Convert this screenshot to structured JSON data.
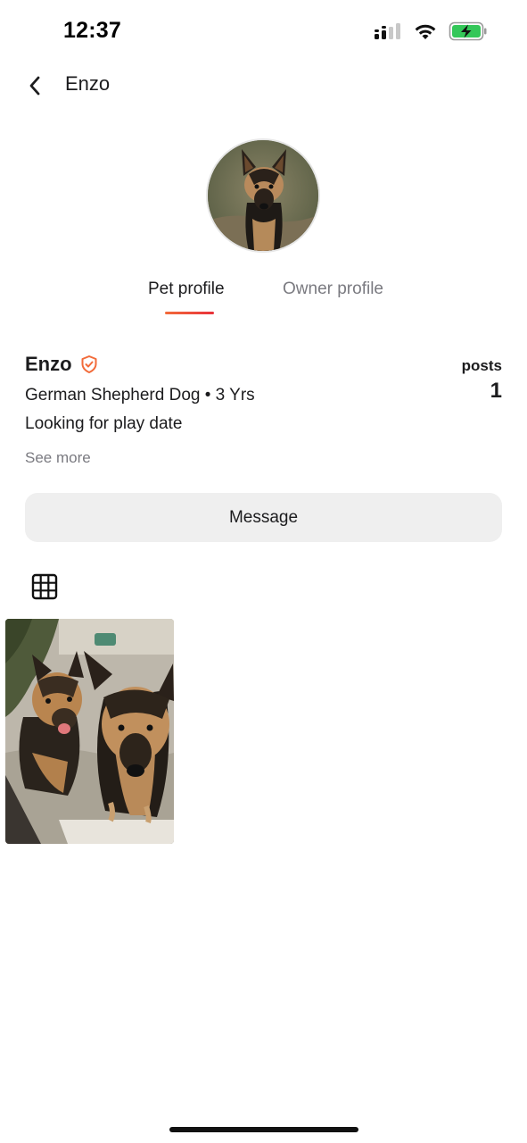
{
  "status_bar": {
    "time": "12:37",
    "icons": [
      "cellular-signal-icon",
      "wifi-icon",
      "battery-charging-icon"
    ]
  },
  "header": {
    "back_icon": "chevron-left-icon",
    "title": "Enzo"
  },
  "tabs": [
    {
      "label": "Pet profile",
      "active": true
    },
    {
      "label": "Owner profile",
      "active": false
    }
  ],
  "profile": {
    "name": "Enzo",
    "verified_icon": "shield-check-icon",
    "breed_age": "German Shepherd Dog • 3 Yrs",
    "bio": "Looking for play date",
    "see_more": "See more",
    "posts_label": "posts",
    "posts_count": "1"
  },
  "actions": {
    "message_label": "Message"
  },
  "posts_view": {
    "icon": "grid-icon"
  },
  "colors": {
    "accent": "#f26b3a",
    "tab_active_underline_end": "#e8313a",
    "muted_text": "#7a7a80",
    "button_bg": "#efefef",
    "battery_green": "#34c759"
  }
}
